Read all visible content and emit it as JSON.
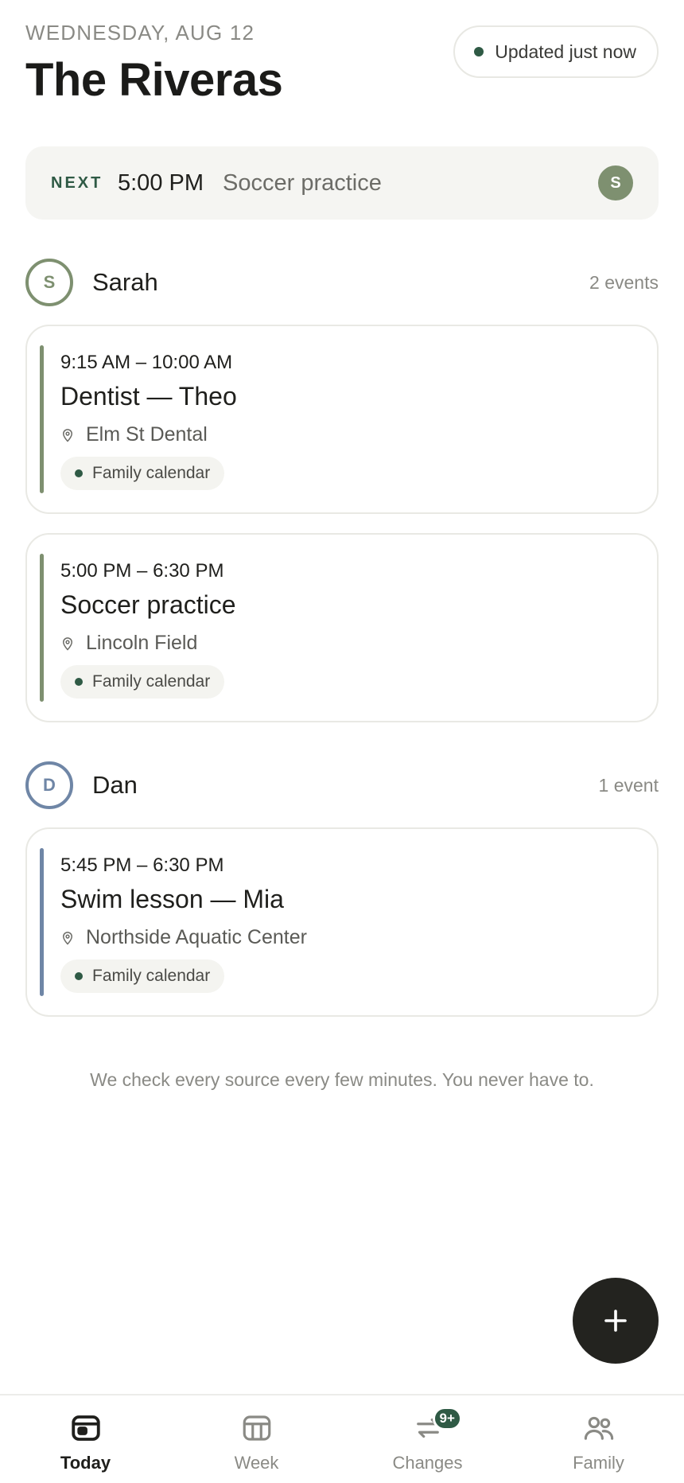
{
  "header": {
    "date": "WEDNESDAY, AUG 12",
    "title": "The Riveras",
    "updated": "Updated just now"
  },
  "next": {
    "label": "NEXT",
    "time": "5:00 PM",
    "title": "Soccer practice",
    "avatar_initial": "S"
  },
  "people": [
    {
      "initial": "S",
      "name": "Sarah",
      "count": "2 events",
      "color": "#7e9070",
      "events": [
        {
          "time": "9:15 AM – 10:00 AM",
          "title": "Dentist — Theo",
          "location": "Elm St Dental",
          "calendar": "Family calendar"
        },
        {
          "time": "5:00 PM – 6:30 PM",
          "title": "Soccer practice",
          "location": "Lincoln Field",
          "calendar": "Family calendar"
        }
      ]
    },
    {
      "initial": "D",
      "name": "Dan",
      "count": "1 event",
      "color": "#6f86a6",
      "events": [
        {
          "time": "5:45 PM – 6:30 PM",
          "title": "Swim lesson — Mia",
          "location": "Northside Aquatic Center",
          "calendar": "Family calendar"
        }
      ]
    }
  ],
  "footnote": "We check every source every few minutes. You never have to.",
  "tabs": [
    {
      "label": "Today",
      "icon": "calendar-today-icon",
      "active": true
    },
    {
      "label": "Week",
      "icon": "week-grid-icon",
      "active": false
    },
    {
      "label": "Changes",
      "icon": "swap-arrows-icon",
      "active": false,
      "badge": "9+"
    },
    {
      "label": "Family",
      "icon": "people-icon",
      "active": false
    }
  ],
  "colors": {
    "accent": "#2f5a45",
    "fab": "#23231f"
  }
}
